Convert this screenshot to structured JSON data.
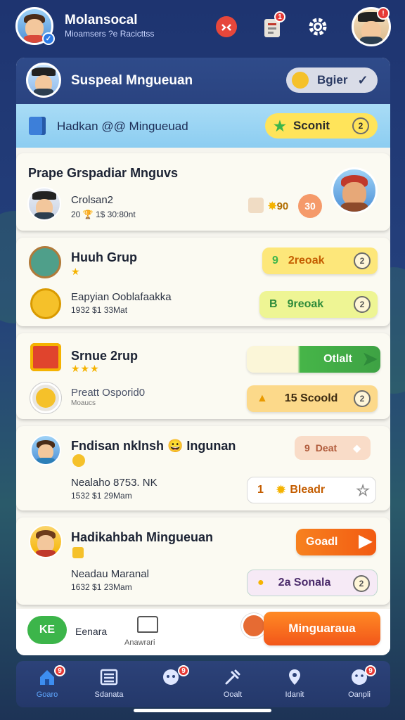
{
  "header": {
    "title": "Molansocal",
    "subtitle": "Mioamsers ?e Racicttss",
    "icons": [
      "alert-icon",
      "clipboard-icon",
      "gear-icon"
    ],
    "notification_badge": "1",
    "profile_badge": "!"
  },
  "profile_row": {
    "title": "Suspeal Mngueuan",
    "pill_label": "Bgier"
  },
  "info_row": {
    "title": "Hadkan @@ Mingueuad",
    "pill_label": "Sconit",
    "clock_label": "2"
  },
  "feature_card": {
    "heading": "Prape Grspadiar Mnguvs",
    "user_name": "Crolsan2",
    "user_meta": "20 🏆 1$ 30:80nt",
    "points": "90",
    "level": "30"
  },
  "groups": [
    {
      "title": "Huuh Grup",
      "stars": "★",
      "sub_title": "Eapyian Ooblafaakka",
      "sub_meta": "1932 $1 33Mat",
      "action1_label": "2reoak",
      "action1_prefix": "9",
      "action1_clock": "2",
      "action2_label": "9reoak",
      "action2_prefix": "B",
      "action2_clock": "2"
    },
    {
      "title": "Srnue 2rup",
      "stars": "★★★",
      "sub_title": "Preatt Osporid0",
      "sub_meta": "Moaucs",
      "action1_label": "Otlalt",
      "action2_label": "15 Scoold",
      "action2_clock": "2"
    },
    {
      "title": "Fndisan nklnsh 😀 Ingunan",
      "sub_title": "Nealaho 8753. NK",
      "sub_meta": "1532 $1 29Mam",
      "action1_label": "Deat",
      "action1_prefix": "9",
      "action2_label": "Bleadr",
      "action2_prefix": "1"
    },
    {
      "title": "Hadikahbah Mingueuan",
      "sub_title": "Neadau Maranal",
      "sub_meta": "1632 $1 23Mam",
      "action1_label": "Goadl",
      "action2_label": "2a Sonala",
      "action2_clock": "2"
    }
  ],
  "bottom_bar": {
    "badge_label": "KE",
    "label1": "Eenara",
    "label2": "Anawrari",
    "cta_label": "Minguaraua"
  },
  "tabs": [
    {
      "label": "Goaro",
      "icon": "home-icon",
      "badge": "9"
    },
    {
      "label": "Sdanata",
      "icon": "list-icon",
      "badge": ""
    },
    {
      "label": "",
      "icon": "chat-icon",
      "badge": "9"
    },
    {
      "label": "Ooalt",
      "icon": "tools-icon",
      "badge": ""
    },
    {
      "label": "Idanit",
      "icon": "location-icon",
      "badge": ""
    },
    {
      "label": "Oanpli",
      "icon": "smile-icon",
      "badge": "9"
    }
  ],
  "colors": {
    "header_bg": "#1e3470",
    "accent_orange": "#ff7a1a",
    "accent_green": "#3cb54a",
    "pill_yellow": "#ffe45a"
  }
}
